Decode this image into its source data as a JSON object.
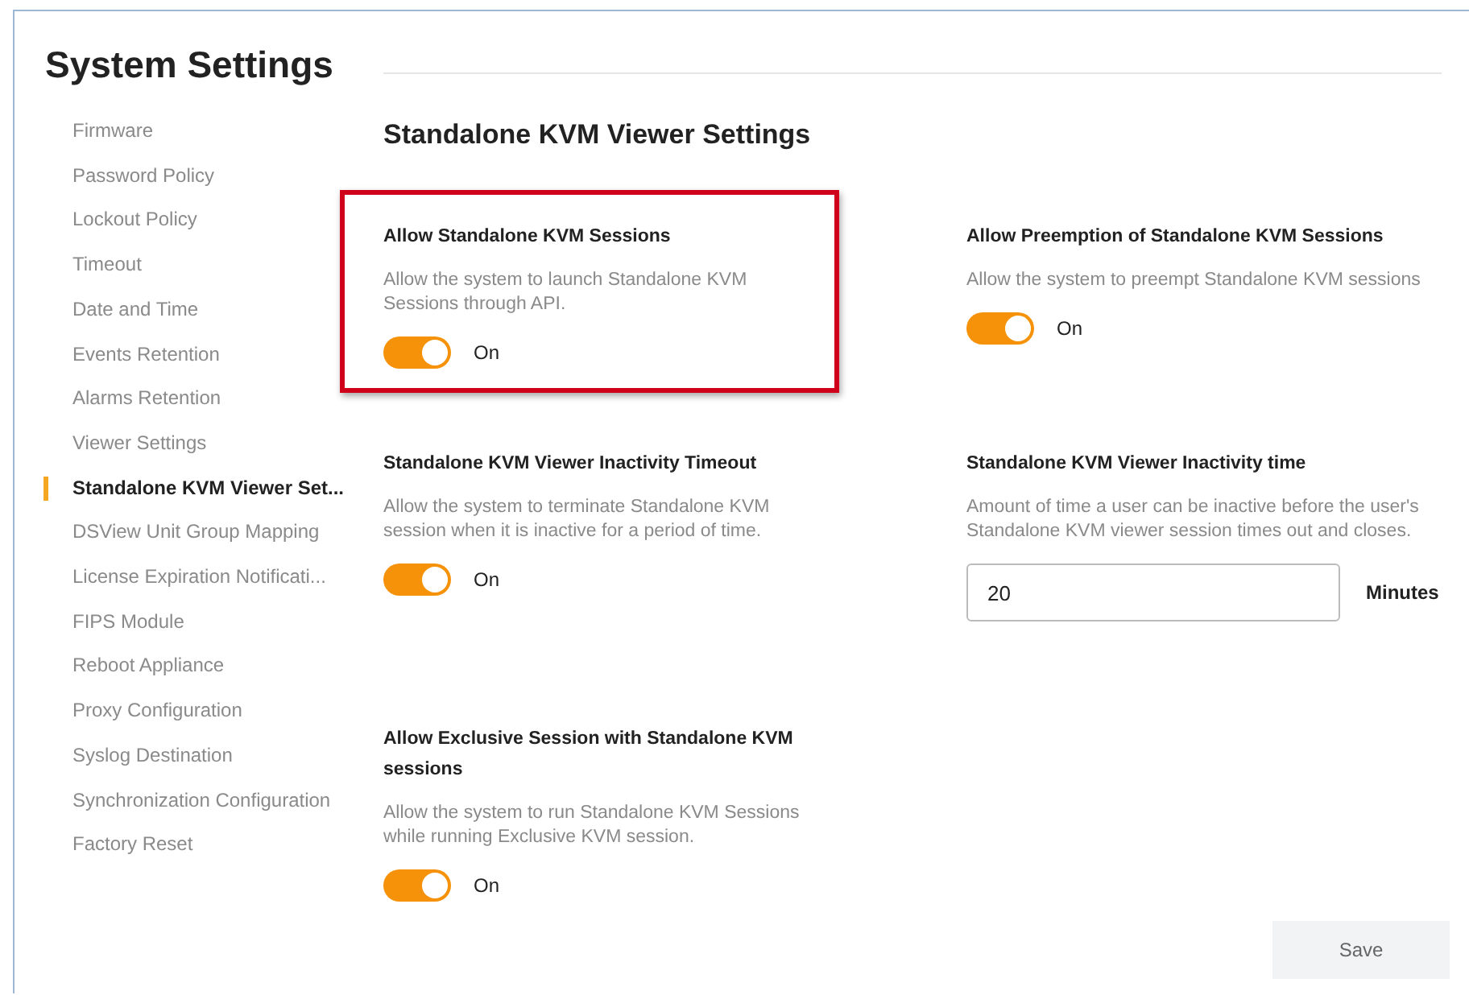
{
  "page_title": "System Settings",
  "sidebar": {
    "items": [
      {
        "label": "Firmware",
        "selected": false
      },
      {
        "label": "Password Policy",
        "selected": false
      },
      {
        "label": "Lockout Policy",
        "selected": false
      },
      {
        "label": "Timeout",
        "selected": false
      },
      {
        "label": "Date and Time",
        "selected": false
      },
      {
        "label": "Events Retention",
        "selected": false
      },
      {
        "label": "Alarms Retention",
        "selected": false
      },
      {
        "label": "Viewer Settings",
        "selected": false
      },
      {
        "label": "Standalone KVM Viewer Set...",
        "selected": true
      },
      {
        "label": "DSView Unit Group Mapping",
        "selected": false
      },
      {
        "label": "License Expiration Notificati...",
        "selected": false
      },
      {
        "label": "FIPS Module",
        "selected": false
      },
      {
        "label": "Reboot Appliance",
        "selected": false
      },
      {
        "label": "Proxy Configuration",
        "selected": false
      },
      {
        "label": "Syslog Destination",
        "selected": false
      },
      {
        "label": "Synchronization Configuration",
        "selected": false
      },
      {
        "label": "Factory Reset",
        "selected": false
      }
    ]
  },
  "section_title": "Standalone KVM Viewer Settings",
  "settings": [
    {
      "kind": "toggle",
      "title": "Allow Standalone KVM Sessions",
      "description": "Allow the system to launch Standalone KVM Sessions through API.",
      "on": true,
      "state_label": "On",
      "highlighted": true
    },
    {
      "kind": "toggle",
      "title": "Allow Preemption of Standalone KVM Sessions",
      "description": "Allow the system to preempt Standalone KVM sessions",
      "on": true,
      "state_label": "On",
      "highlighted": false
    },
    {
      "kind": "toggle",
      "title": "Standalone KVM Viewer Inactivity Timeout",
      "description": "Allow the system to terminate Standalone KVM session when it is inactive for a period of time.",
      "on": true,
      "state_label": "On",
      "highlighted": false
    },
    {
      "kind": "number",
      "title": "Standalone KVM Viewer Inactivity time",
      "description": "Amount of time a user can be inactive before the user's Standalone KVM viewer session times out and closes.",
      "value": "20",
      "unit": "Minutes",
      "highlighted": false
    },
    {
      "kind": "toggle",
      "title": "Allow Exclusive Session with Standalone KVM sessions",
      "description": "Allow the system to run Standalone KVM Sessions while running Exclusive KVM session.",
      "on": true,
      "state_label": "On",
      "highlighted": false
    }
  ],
  "save_button": "Save"
}
